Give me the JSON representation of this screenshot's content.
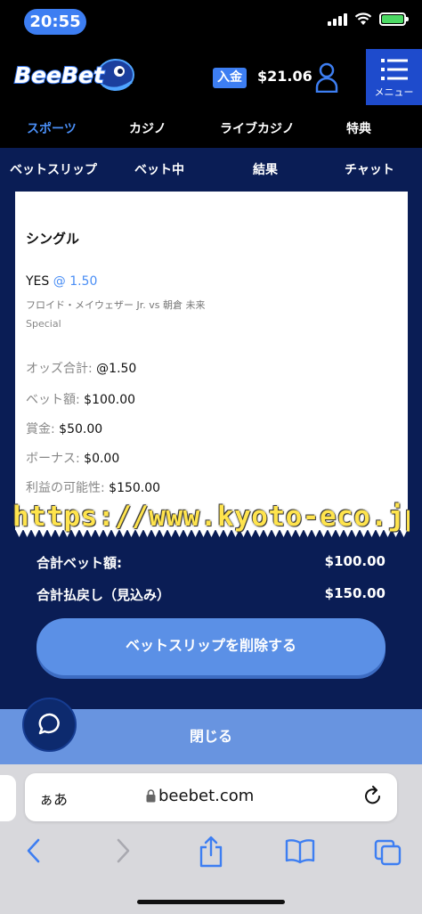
{
  "status_bar": {
    "time": "20:55"
  },
  "header": {
    "logo_text": "BeeBet",
    "deposit_label": "入金",
    "balance": "$21.06",
    "menu_label": "メニュー"
  },
  "main_nav": [
    "スポーツ",
    "カジノ",
    "ライブカジノ",
    "特典"
  ],
  "sub_tabs": [
    "ベットスリップ",
    "ベット中",
    "結果",
    "チャット"
  ],
  "bet_slip": {
    "type": "シングル",
    "selection": "YES",
    "odds_display": "@ 1.50",
    "match": "フロイド・メイウェザー Jr. vs 朝倉 未来",
    "market": "Special",
    "rows": [
      {
        "label": "オッズ合計:",
        "value": "@1.50"
      },
      {
        "label": "ベット額:",
        "value": "$100.00"
      },
      {
        "label": "賞金:",
        "value": "$50.00"
      },
      {
        "label": "ボーナス:",
        "value": "$0.00"
      },
      {
        "label": "利益の可能性:",
        "value": "$150.00"
      }
    ]
  },
  "watermark": "https://www.kyoto-eco.jp/",
  "totals": {
    "total_bet_label": "合計ベット額:",
    "total_bet_value": "$100.00",
    "payout_label": "合計払戻し（見込み）",
    "payout_value": "$150.00"
  },
  "delete_button": "ベットスリップを削除する",
  "close_button": "閉じる",
  "browser": {
    "aa_label": "ぁあ",
    "url": "beebet.com"
  },
  "colors": {
    "accent": "#3d7ef2",
    "navy": "#0a1d55",
    "button": "#5b90e6",
    "watermark": "#ffe44d"
  }
}
